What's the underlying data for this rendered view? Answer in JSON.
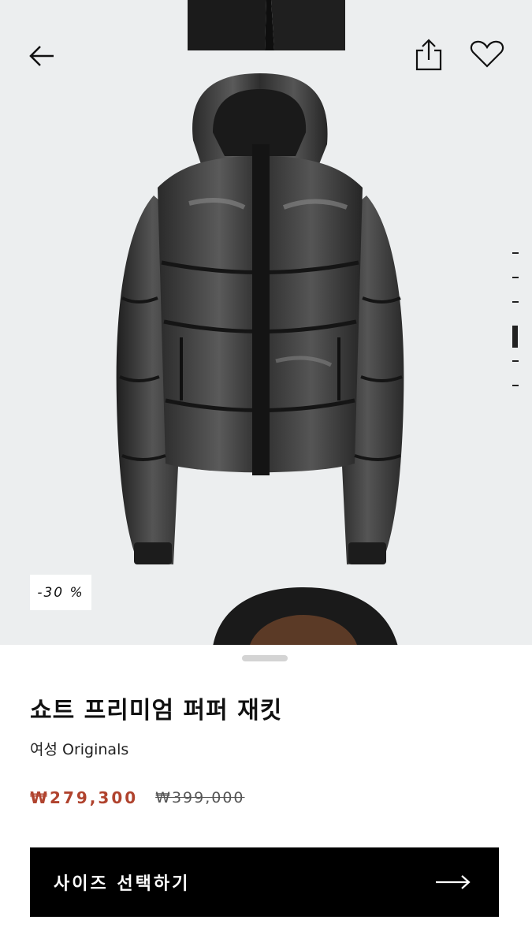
{
  "header": {
    "back_icon": "arrow-left-icon",
    "share_icon": "share-icon",
    "wishlist_icon": "heart-icon"
  },
  "gallery": {
    "slide_count": 6,
    "active_slide": 4,
    "discount_badge": "-30 %"
  },
  "product": {
    "name": "쇼트 프리미엄 퍼퍼 재킷",
    "category": "여성 Originals",
    "sale_price": "₩279,300",
    "original_price": "₩399,000"
  },
  "cta": {
    "label": "사이즈 선택하기",
    "icon": "arrow-right-icon"
  },
  "colors": {
    "sale_price": "#b0432e",
    "background": "#eceeef",
    "button": "#000000"
  }
}
